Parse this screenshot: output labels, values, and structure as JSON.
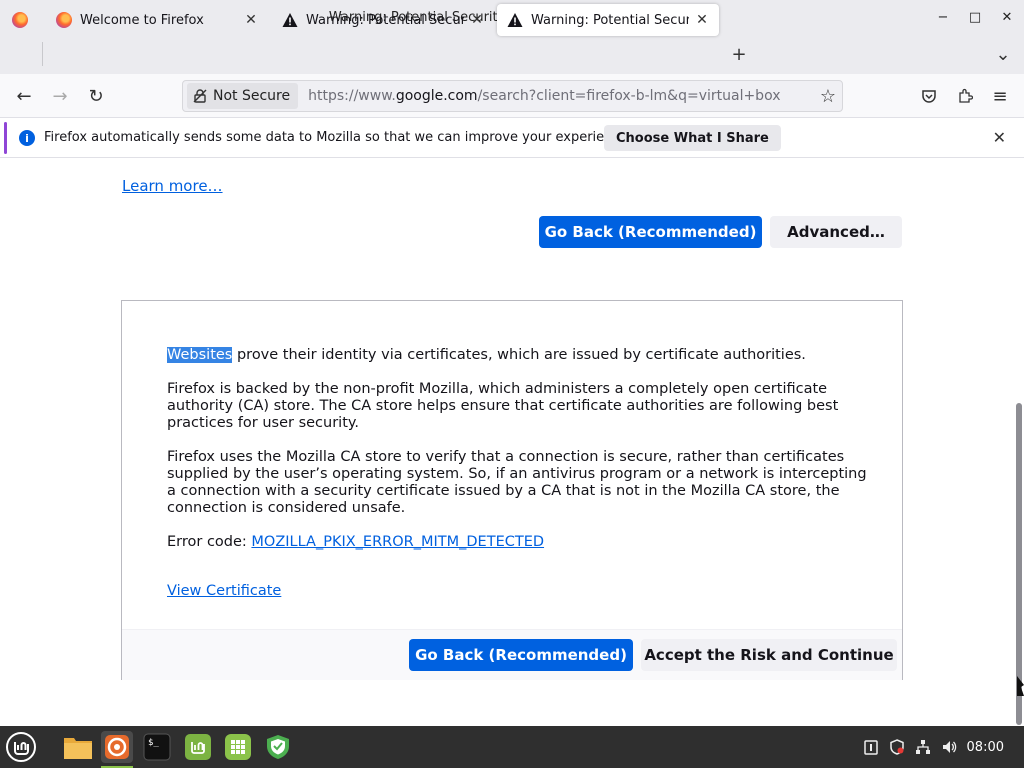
{
  "window": {
    "title": "Warning: Potential Security Risk Ahead — Mozilla Firefox",
    "minimize_glyph": "−",
    "maximize_glyph": "□",
    "close_glyph": "✕"
  },
  "tabs": [
    {
      "label": "Welcome to Firefox",
      "icon": "firefox-icon",
      "active": false
    },
    {
      "label": "Warning: Potential Security Risk Ahead",
      "icon": "warning-icon",
      "active": false
    },
    {
      "label": "Warning: Potential Security Risk Ahead",
      "icon": "warning-icon",
      "active": true
    }
  ],
  "tabstrip": {
    "new_tab_glyph": "+",
    "list_all_glyph": "⌄"
  },
  "navbar": {
    "back_glyph": "←",
    "forward_glyph": "→",
    "reload_glyph": "↻",
    "security_label": "Not Secure",
    "url_prefix": "https://www.",
    "url_host": "google.com",
    "url_rest": "/search?client=firefox-b-lm&q=virtual+box",
    "bookmark_glyph": "☆",
    "menu_glyph": "≡"
  },
  "notification": {
    "text": "Firefox automatically sends some data to Mozilla so that we can improve your experience.",
    "button": "Choose What I Share",
    "info_glyph": "i",
    "close_glyph": "✕"
  },
  "page": {
    "learn_more": "Learn more…",
    "go_back": "Go Back (Recommended)",
    "advanced": "Advanced…",
    "panel": {
      "highlighted_word": "Websites",
      "p1_rest": " prove their identity via certificates, which are issued by certificate authorities.",
      "p2": "Firefox is backed by the non-profit Mozilla, which administers a completely open certificate authority (CA) store. The CA store helps ensure that certificate authorities are following best practices for user security.",
      "p3": "Firefox uses the Mozilla CA store to verify that a connection is secure, rather than certificates supplied by the user’s operating system. So, if an antivirus program or a network is intercepting a connection with a security certificate issued by a CA that is not in the Mozilla CA store, the connection is considered unsafe.",
      "error_label": "Error code: ",
      "error_code": "MOZILLA_PKIX_ERROR_MITM_DETECTED",
      "view_certificate": "View Certificate",
      "go_back": "Go Back (Recommended)",
      "accept": "Accept the Risk and Continue"
    }
  },
  "taskbar": {
    "apps": [
      "mint-menu-icon",
      "files-icon",
      "firefox-icon",
      "terminal-icon",
      "mintinstall-icon",
      "spreadsheet-icon",
      "shield-icon"
    ],
    "clock": "08:00"
  },
  "colors": {
    "accent": "#0061e0",
    "taskbar": "#2f2f2f",
    "highlight": "#3584e4"
  }
}
